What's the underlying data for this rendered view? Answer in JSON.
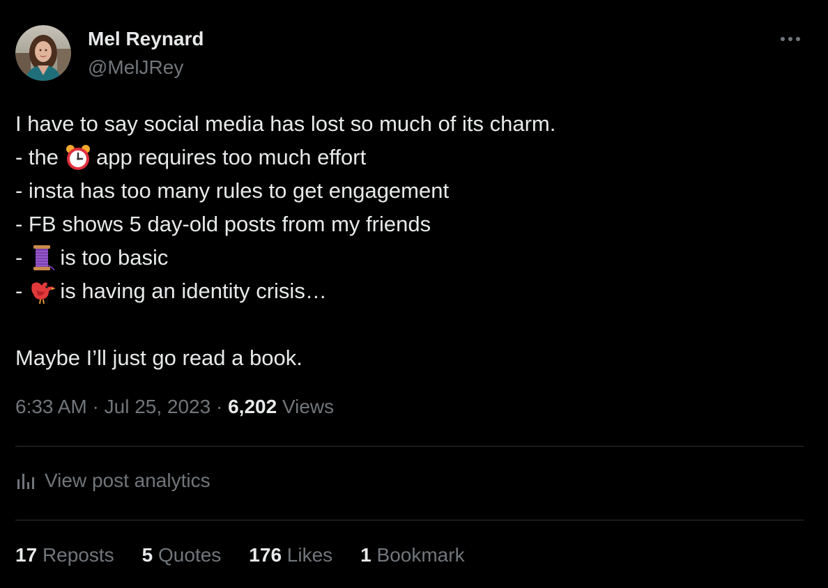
{
  "author": {
    "display_name": "Mel Reynard",
    "handle": "@MelJRey",
    "avatar": "avatar-photo"
  },
  "post": {
    "lines": [
      {
        "prefix": "I have to say social media has lost so much of its charm.",
        "emoji": null,
        "suffix": ""
      },
      {
        "prefix": "- the",
        "emoji": "alarm-clock-emoji",
        "suffix": "app requires too much effort"
      },
      {
        "prefix": "- insta has too many rules to get engagement",
        "emoji": null,
        "suffix": ""
      },
      {
        "prefix": "- FB shows 5 day-old posts from my friends",
        "emoji": null,
        "suffix": ""
      },
      {
        "prefix": "-",
        "emoji": "thread-spool-emoji",
        "suffix": "is too basic"
      },
      {
        "prefix": "-",
        "emoji": "bird-emoji",
        "suffix": "is having an identity crisis…"
      },
      {
        "prefix": "",
        "emoji": null,
        "suffix": ""
      },
      {
        "prefix": "Maybe I’ll just go read a book.",
        "emoji": null,
        "suffix": ""
      }
    ]
  },
  "meta": {
    "time": "6:33 AM",
    "separator": "·",
    "date": "Jul 25, 2023",
    "views_count": "6,202",
    "views_label": "Views"
  },
  "analytics": {
    "label": "View post analytics",
    "icon": "bar-chart-icon"
  },
  "stats": [
    {
      "count": "17",
      "label": "Reposts"
    },
    {
      "count": "5",
      "label": "Quotes"
    },
    {
      "count": "176",
      "label": "Likes"
    },
    {
      "count": "1",
      "label": "Bookmark"
    }
  ],
  "more_icon": "more-horizontal-icon",
  "colors": {
    "background": "#000000",
    "primary_text": "#e7e9ea",
    "secondary_text": "#71767b",
    "divider": "#2f3336"
  }
}
